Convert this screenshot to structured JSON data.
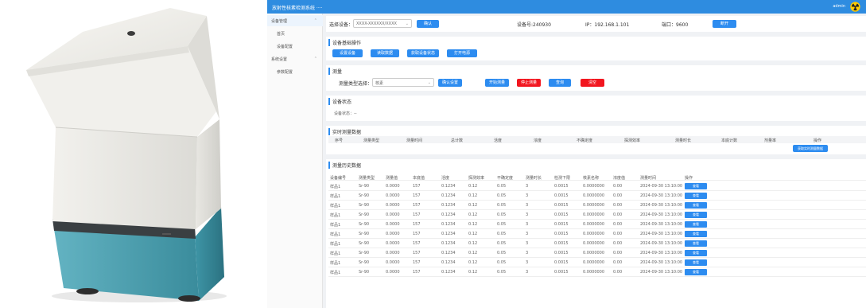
{
  "app": {
    "title": "放射性核素检测系统 ····",
    "user": "admin"
  },
  "sidebar": {
    "items": [
      {
        "label": "设备管理",
        "arrow": "⌃"
      },
      {
        "label": "首页",
        "arrow": ""
      },
      {
        "label": "设备配置",
        "arrow": ""
      },
      {
        "label": "系统设置",
        "arrow": "⌃"
      },
      {
        "label": "参数配置",
        "arrow": ""
      }
    ]
  },
  "header": {
    "device_label": "选择设备：",
    "device_value": "XXXX-XXXXXX/XXXX",
    "connect_label": "确认",
    "device_no": "设备号:240930",
    "ip": "IP：192.168.1.101",
    "port": "端口：9600",
    "disconnect_label": "断开"
  },
  "section_ops": {
    "title": "设备基础操作",
    "buttons": [
      "设置设备",
      "读取数据",
      "获取设备状态",
      "打开电源"
    ]
  },
  "section_measure": {
    "title": "测量",
    "type_label": "测量类型选择：",
    "type_value": "核素",
    "confirm": "确认设置",
    "start": "开始测量",
    "stop": "停止测量",
    "query": "查询",
    "clear": "清空"
  },
  "section_status": {
    "title": "设备状态",
    "text": "设备状态：--"
  },
  "section_live": {
    "title": "实时测量数据",
    "columns": [
      "序号",
      "测量类型",
      "测量时间",
      "总计数",
      "活度",
      "浓度",
      "不确定度",
      "探测效率",
      "测量时长",
      "本底计数",
      "剂量率",
      "操作"
    ],
    "action": "获取实时测量数据"
  },
  "section_history": {
    "title": "测量历史数据",
    "columns": [
      "设备编号",
      "测量类型",
      "测量值",
      "本底值",
      "活度",
      "探测效率",
      "不确定度",
      "测量时长",
      "检测下限",
      "核素名称",
      "浓度值",
      "测量时间",
      "操作"
    ],
    "rows": [
      [
        "样品1",
        "Sr-90",
        "0.0000",
        "157",
        "0.1234",
        "0.12",
        "0.05",
        "3",
        "0.0015",
        "0.0000000",
        "0.00",
        "2024-09-30 13:10:00",
        "查看"
      ],
      [
        "样品1",
        "Sr-90",
        "0.0000",
        "157",
        "0.1234",
        "0.12",
        "0.05",
        "3",
        "0.0015",
        "0.0000000",
        "0.00",
        "2024-09-30 13:10:00",
        "查看"
      ],
      [
        "样品1",
        "Sr-90",
        "0.0000",
        "157",
        "0.1234",
        "0.12",
        "0.05",
        "3",
        "0.0015",
        "0.0000000",
        "0.00",
        "2024-09-30 13:10:00",
        "查看"
      ],
      [
        "样品1",
        "Sr-90",
        "0.0000",
        "157",
        "0.1234",
        "0.12",
        "0.05",
        "3",
        "0.0015",
        "0.0000000",
        "0.00",
        "2024-09-30 13:10:00",
        "查看"
      ],
      [
        "样品1",
        "Sr-90",
        "0.0000",
        "157",
        "0.1234",
        "0.12",
        "0.05",
        "3",
        "0.0015",
        "0.0000000",
        "0.00",
        "2024-09-30 13:10:00",
        "查看"
      ],
      [
        "样品1",
        "Sr-90",
        "0.0000",
        "157",
        "0.1234",
        "0.12",
        "0.05",
        "3",
        "0.0015",
        "0.0000000",
        "0.00",
        "2024-09-30 13:10:00",
        "查看"
      ],
      [
        "样品1",
        "Sr-90",
        "0.0000",
        "157",
        "0.1234",
        "0.12",
        "0.05",
        "3",
        "0.0015",
        "0.0000000",
        "0.00",
        "2024-09-30 13:10:00",
        "查看"
      ],
      [
        "样品1",
        "Sr-90",
        "0.0000",
        "157",
        "0.1234",
        "0.12",
        "0.05",
        "3",
        "0.0015",
        "0.0000000",
        "0.00",
        "2024-09-30 13:10:00",
        "查看"
      ],
      [
        "样品1",
        "Sr-90",
        "0.0000",
        "157",
        "0.1234",
        "0.12",
        "0.05",
        "3",
        "0.0015",
        "0.0000000",
        "0.00",
        "2024-09-30 13:10:00",
        "查看"
      ],
      [
        "样品1",
        "Sr-90",
        "0.0000",
        "157",
        "0.1234",
        "0.12",
        "0.05",
        "3",
        "0.0015",
        "0.0000000",
        "0.00",
        "2024-09-30 13:10:00",
        "查看"
      ]
    ]
  },
  "icons": {
    "radiation": "radiation-icon",
    "dropdown": "chevron-down-icon"
  },
  "colors": {
    "primary": "#2d8cf0",
    "topbar": "#2e8ce0",
    "danger": "#f2161f",
    "device_top": "#f3f3f1",
    "device_base": "#4ba3b4"
  }
}
